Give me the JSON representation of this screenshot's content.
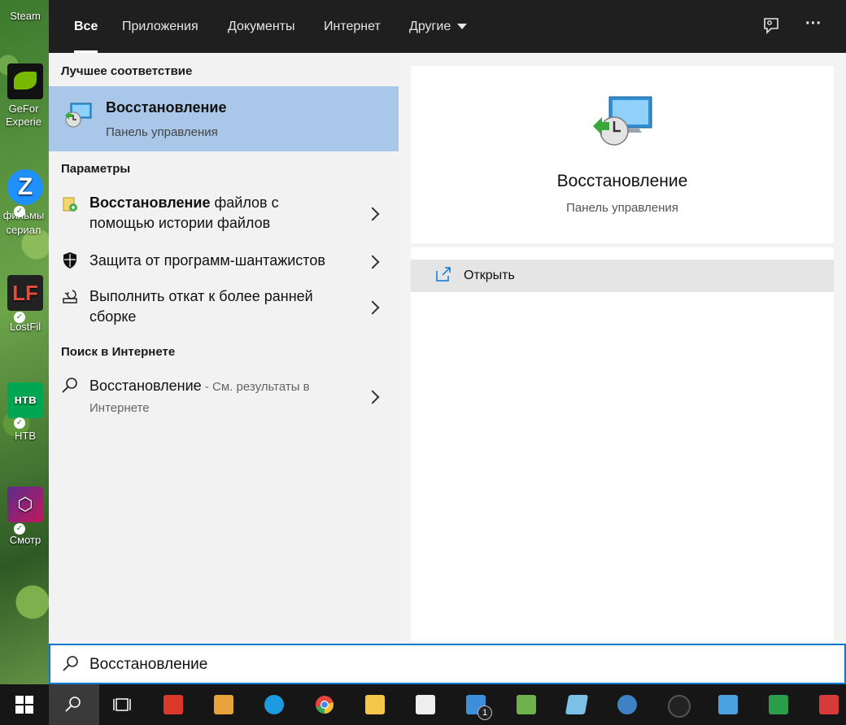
{
  "desktop_icons": [
    {
      "label": "Steam",
      "color": "#1b2838"
    },
    {
      "label": "GeFor Experie",
      "color": "#76b900"
    },
    {
      "label": "фильмы сериал",
      "color": "#1e90ff"
    },
    {
      "label": "LostFil",
      "color": "#222222"
    },
    {
      "label": "НТВ",
      "color": "#00a651"
    },
    {
      "label": "Смотр",
      "color": "#5b2d8e"
    }
  ],
  "tabs": [
    {
      "label": "Все",
      "active": true
    },
    {
      "label": "Приложения",
      "active": false
    },
    {
      "label": "Документы",
      "active": false
    },
    {
      "label": "Интернет",
      "active": false
    },
    {
      "label": "Другие",
      "active": false
    }
  ],
  "toolbar": {
    "feedback_icon": "feedback-icon",
    "more_icon": "more-icon",
    "more_glyph": "···"
  },
  "best_match": {
    "heading": "Лучшее соответствие",
    "title": "Восстановление",
    "subtitle": "Панель управления",
    "icon": "recovery-icon"
  },
  "settings": {
    "heading": "Параметры",
    "items": [
      {
        "bold": "Восстановление",
        "rest_line1": " файлов с",
        "line2": "помощью истории файлов",
        "icon": "file-history-icon"
      },
      {
        "text": "Защита от программ-шантажистов",
        "icon": "shield-icon"
      },
      {
        "line1": "Выполнить откат к более ранней",
        "line2": "сборке",
        "icon": "rollback-icon"
      }
    ]
  },
  "web": {
    "heading": "Поиск в Интернете",
    "query": "Восстановление",
    "hint_line1": " - См. результаты в",
    "hint_line2": "Интернете",
    "icon": "search-icon"
  },
  "preview": {
    "title": "Восстановление",
    "subtitle": "Панель управления",
    "open_label": "Открыть"
  },
  "search": {
    "value": "Восстановление"
  },
  "taskbar": {
    "items": [
      {
        "name": "start",
        "color": "#ffffff"
      },
      {
        "name": "search",
        "color": "#ffffff"
      },
      {
        "name": "task-view",
        "color": "#ffffff"
      },
      {
        "name": "app-red",
        "color": "#d9382b"
      },
      {
        "name": "app-archive",
        "color": "#e8a33d"
      },
      {
        "name": "edge",
        "color": "#1e9be0"
      },
      {
        "name": "chrome",
        "color": "#e8453c"
      },
      {
        "name": "explorer",
        "color": "#f4c74a"
      },
      {
        "name": "store",
        "color": "#eeeeee"
      },
      {
        "name": "mail",
        "color": "#3c8fd9"
      },
      {
        "name": "notepad-app",
        "color": "#6fb24b"
      },
      {
        "name": "writer",
        "color": "#7cc0e6"
      },
      {
        "name": "qbittorrent",
        "color": "#3d82c4"
      },
      {
        "name": "app-black",
        "color": "#222222"
      },
      {
        "name": "control-panel",
        "color": "#4aa3df"
      },
      {
        "name": "app-ge",
        "color": "#2a9d4a"
      },
      {
        "name": "app-news",
        "color": "#d63a3a"
      }
    ],
    "mail_badge": "1"
  }
}
